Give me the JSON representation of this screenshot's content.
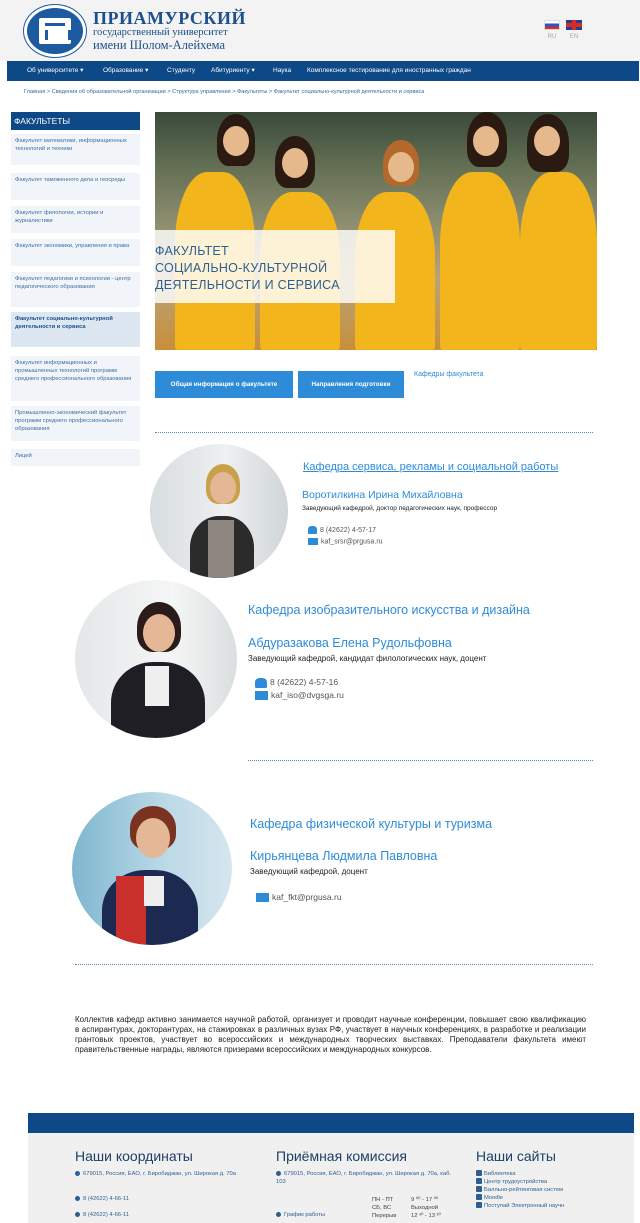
{
  "header": {
    "logo_icon": "university-crest",
    "uni_line1": "ПРИАМУРСКИЙ",
    "uni_line2": "государственный университет",
    "uni_line3": "имени Шолом-Алейхема",
    "lang_ru": "RU",
    "lang_en": "EN"
  },
  "nav": {
    "items": [
      {
        "label": "Об университете ▾"
      },
      {
        "label": "Образование ▾"
      },
      {
        "label": "Студенту"
      },
      {
        "label": "Абитуриенту ▾"
      },
      {
        "label": "Наука"
      },
      {
        "label": "Комплексное тестирование для иностранных граждан"
      }
    ]
  },
  "breadcrumb": "Главная > Сведения об образовательной организации > Структура управления > Факультеты > Факультет социально-культурной деятельности и сервиса",
  "sidebar": {
    "title": "ФАКУЛЬТЕТЫ",
    "items": [
      {
        "label": "Факультет математики, информационных технологий и техники"
      },
      {
        "label": "Факультет таможенного дела и геосреды"
      },
      {
        "label": "Факультет филологии, истории и журналистики"
      },
      {
        "label": "Факультет экономики, управления и права"
      },
      {
        "label": "Факультет педагогики и психологии - центр педагогического образования"
      },
      {
        "label": "Факультет социально-культурной деятельности и сервиса"
      },
      {
        "label": "Факультет информационных и промышленных технологий программ среднего профессионального образования"
      },
      {
        "label": "Промышленно-экономический факультет программ среднего профессионального образования"
      },
      {
        "label": "Лицей"
      }
    ]
  },
  "hero": {
    "line1": "ФАКУЛЬТЕТ",
    "line2": "СОЦИАЛЬНО-КУЛЬТУРНОЙ",
    "line3": "ДЕЯТЕЛЬНОСТИ И СЕРВИСА"
  },
  "tabs": {
    "t1": "Общая информация о факультете",
    "t2": "Направления подготовки",
    "t3": "Кафедры факультета"
  },
  "departments": [
    {
      "title": "Кафедра сервиса, рекламы и социальной работы",
      "head": "Воротилкина Ирина Михайловна",
      "position": "Заведующий кафедрой, доктор педагогических наук, профессор",
      "phone": "8 (42622) 4-57-17",
      "email": "kaf_srsr@prgusa.ru"
    },
    {
      "title": "Кафедра изобразительного искусства и дизайна",
      "head": "Абдуразакова Елена Рудольфовна",
      "position": "Заведующий кафедрой, кандидат филологических наук, доцент",
      "phone": "8 (42622) 4-57-16",
      "email": "kaf_iso@dvgsga.ru"
    },
    {
      "title": "Кафедра физической культуры и туризма",
      "head": "Кирьянцева Людмила Павловна",
      "position": "Заведующий кафедрой, доцент",
      "email": "kaf_fkt@prgusa.ru"
    }
  ],
  "about": "Коллектив кафедр активно занимается научной работой, организует и проводит научные конференции, повышает свою квалификацию в аспирантурах, докторантурах, на стажировках в различных вузах РФ, участвует в научных конференциях, в разработке и реализации грантовых проектов, участвует во всероссийских и международных творческих выставках. Преподаватели факультета имеют правительственные награды, являются призерами всероссийских и международных конкурсов.",
  "footer": {
    "coords_title": "Наши координаты",
    "coords_address": "679015, Россия, ЕАО, г. Биробиджан, ул. Широкая д. 70а",
    "coords_phone1": "8 (42622) 4-66-11",
    "coords_phone2": "8 (42622) 4-66-11",
    "admission_title": "Приёмная комиссия",
    "admission_address": "679015, Россия, ЕАО, г. Биробиджан, ул. Широкая д. 70а, каб. 103",
    "schedule_label": "График работы",
    "sched_days1": "ПН - ПТ",
    "sched_time1": "9 ⁰⁰ - 17 ⁰⁰",
    "sched_days2": "СБ, ВС",
    "sched_time2": "Выходной",
    "sched_days3": "Перерыв",
    "sched_time3": "12 ³⁰ - 13 ³⁰",
    "sites_title": "Наши сайты",
    "sites": [
      {
        "label": "Библиотека"
      },
      {
        "label": "Центр трудоустройства"
      },
      {
        "label": "Балльно-рейтинговая систем"
      },
      {
        "label": "Moodle"
      },
      {
        "label": "Поступай Электронный научн"
      }
    ]
  },
  "colors": {
    "brand_blue": "#0d4887",
    "accent_blue": "#2e8bd8"
  }
}
